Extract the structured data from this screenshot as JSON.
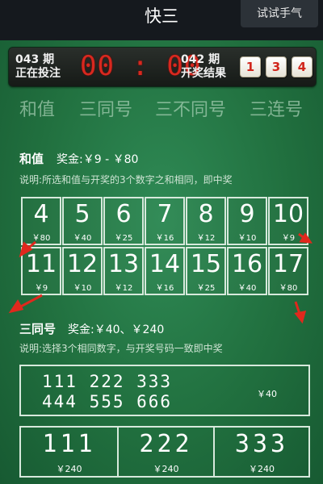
{
  "header": {
    "title": "快三",
    "try_luck": "试试手气"
  },
  "period": {
    "current_issue": "043 期",
    "current_status": "正在投注",
    "countdown": "00 : 00",
    "previous_issue": "042 期",
    "previous_label": "开奖结果",
    "dice": [
      "1",
      "3",
      "4"
    ]
  },
  "tabs": [
    {
      "label": "和值"
    },
    {
      "label": "三同号"
    },
    {
      "label": "三不同号"
    },
    {
      "label": "三连号"
    }
  ],
  "sum": {
    "title": "和值",
    "prize": "奖金:￥9 - ￥80",
    "desc": "说明:所选和值与开奖的3个数字之和相同，即中奖",
    "cells": [
      {
        "num": "4",
        "amt": "￥80"
      },
      {
        "num": "5",
        "amt": "￥40"
      },
      {
        "num": "6",
        "amt": "￥25"
      },
      {
        "num": "7",
        "amt": "￥16"
      },
      {
        "num": "8",
        "amt": "￥12"
      },
      {
        "num": "9",
        "amt": "￥10"
      },
      {
        "num": "10",
        "amt": "￥9"
      },
      {
        "num": "11",
        "amt": "￥9"
      },
      {
        "num": "12",
        "amt": "￥10"
      },
      {
        "num": "13",
        "amt": "￥12"
      },
      {
        "num": "14",
        "amt": "￥16"
      },
      {
        "num": "15",
        "amt": "￥25"
      },
      {
        "num": "16",
        "amt": "￥40"
      },
      {
        "num": "17",
        "amt": "￥80"
      }
    ]
  },
  "triple": {
    "title": "三同号",
    "prize": "奖金:￥40、￥240",
    "desc": "说明:选择3个相同数字，与开奖号码一致即中奖",
    "all_row1": "111  222  333",
    "all_row2": "444  555  666",
    "all_amt": "￥40",
    "singles": [
      {
        "num": "111",
        "amt": "￥240"
      },
      {
        "num": "222",
        "amt": "￥240"
      },
      {
        "num": "333",
        "amt": "￥240"
      }
    ]
  },
  "colors": {
    "felt": "#21703f",
    "countdown": "#d8281f",
    "arrow": "#e0281d"
  }
}
